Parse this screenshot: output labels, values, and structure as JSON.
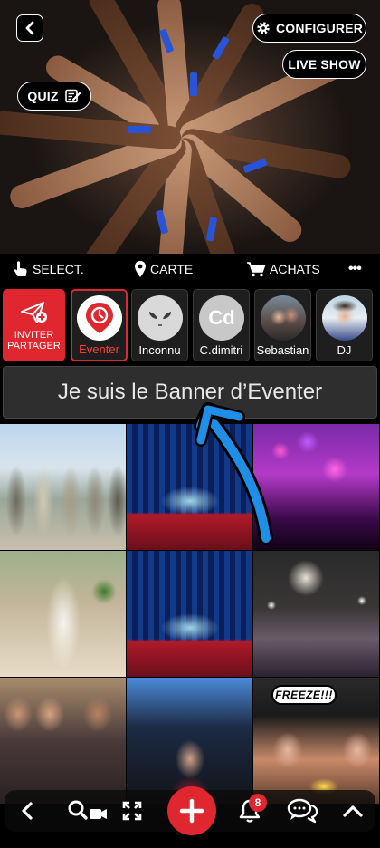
{
  "header": {
    "configure_label": "CONFIGURER",
    "live_show_label": "LIVE SHOW",
    "quiz_label": "QUIZ"
  },
  "action_bar": {
    "select_label": "SELECT.",
    "map_label": "CARTE",
    "purchases_label": "ACHATS",
    "more_label": "•••"
  },
  "stories": {
    "invite_line1": "INVITER",
    "invite_line2": "PARTAGER",
    "items": [
      {
        "label": "Eventer"
      },
      {
        "label": "Inconnu"
      },
      {
        "label": "C.dimitri",
        "initials": "Cd"
      },
      {
        "label": "Sebastian"
      },
      {
        "label": "DJ"
      }
    ]
  },
  "banner": {
    "text": "Je suis le Banner d’Eventer"
  },
  "grid": {
    "freeze_sign": "FREEZE!!!"
  },
  "bottom_nav": {
    "notifications_count": "8"
  },
  "colors": {
    "brand_red": "#e0262e",
    "arrow_blue": "#1e8ee6"
  }
}
